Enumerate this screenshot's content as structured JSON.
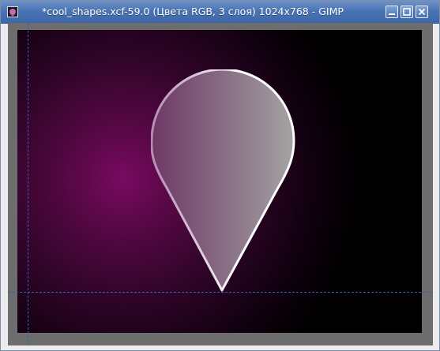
{
  "window": {
    "title": "*cool_shapes.xcf-59.0 (Цвета RGB, 3 слоя) 1024x768 - GIMP",
    "app_icon": "gimp-icon",
    "controls": [
      "minimize-icon",
      "maximize-icon",
      "close-icon"
    ]
  },
  "canvas": {
    "background_colors": [
      "#7a0a62",
      "#000000"
    ],
    "shape": {
      "type": "teardrop",
      "fill_gradient": [
        "#6f3a67",
        "#a8a8a8"
      ],
      "stroke": "#ffffff"
    },
    "guide_color": "#3b5fb0"
  }
}
